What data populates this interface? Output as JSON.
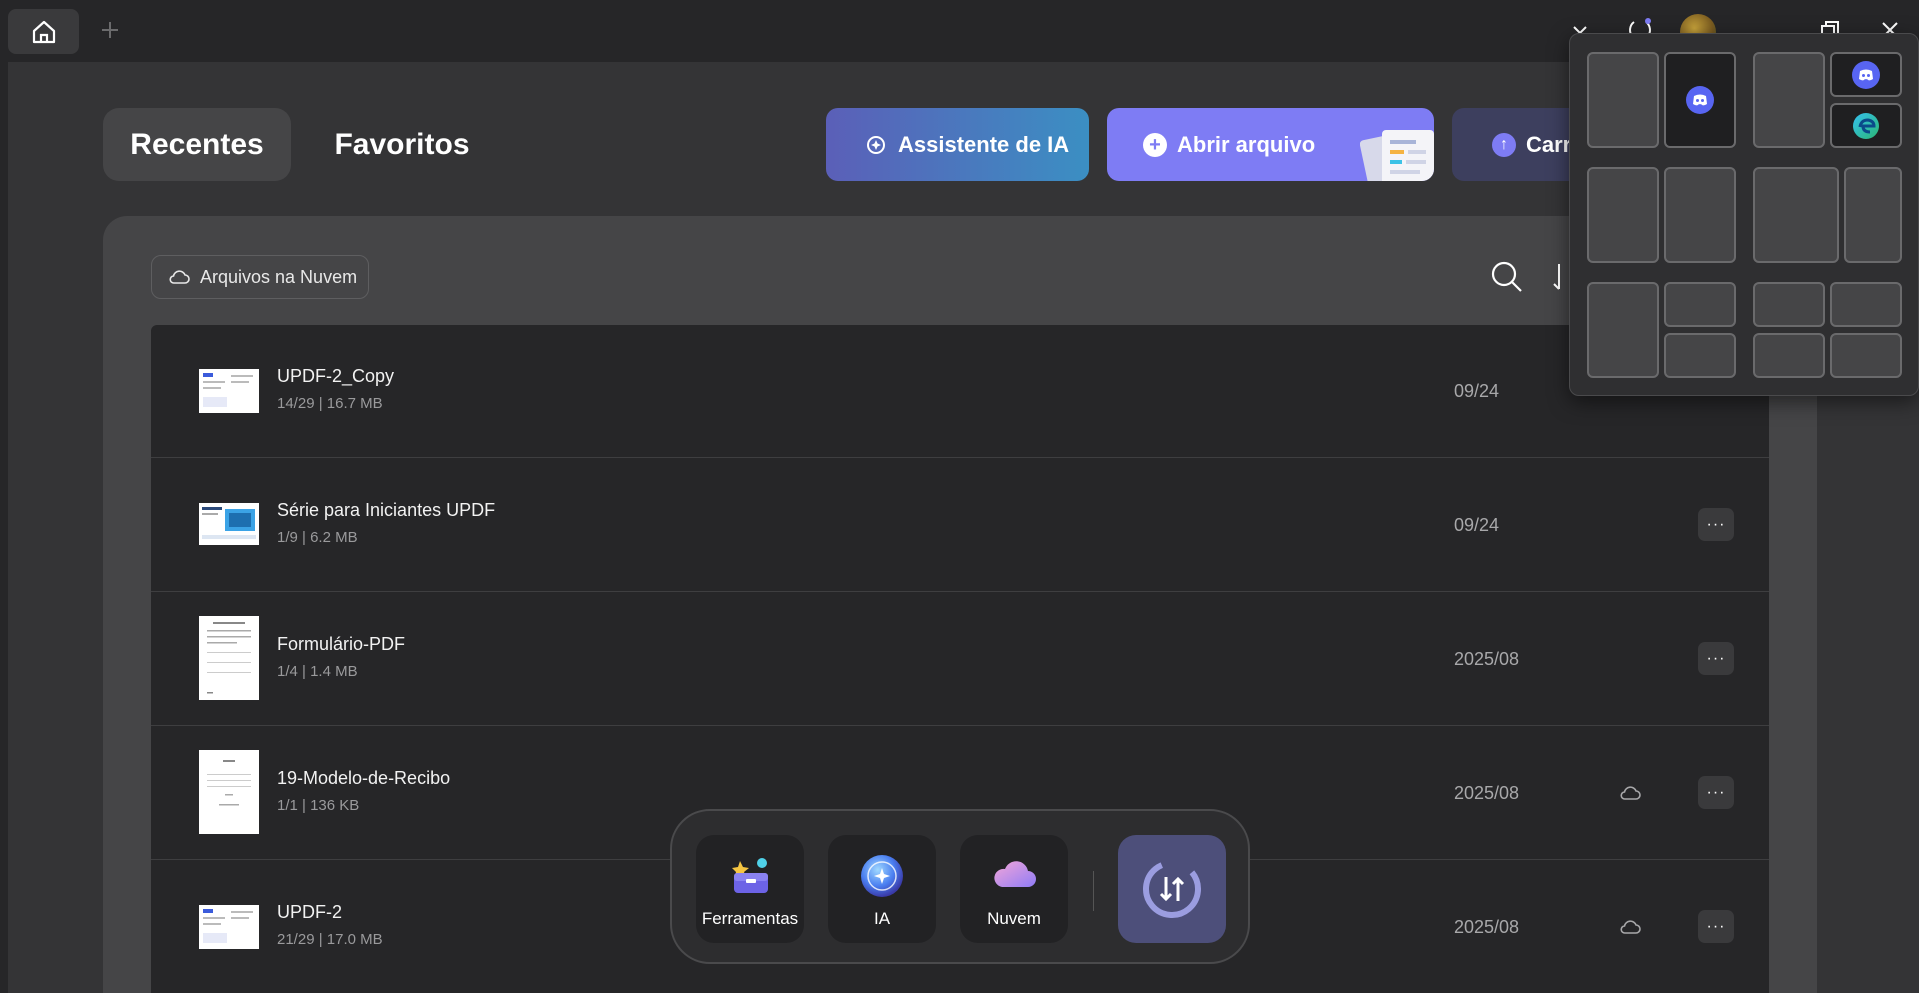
{
  "titlebar": {
    "home_icon": "home-icon",
    "new_tab_icon": "plus-icon",
    "controls": [
      "chevron-down-icon",
      "sync-icon",
      "avatar",
      "minimize-icon",
      "restore-icon",
      "close-icon"
    ]
  },
  "nav": {
    "recent_label": "Recentes",
    "favorites_label": "Favoritos"
  },
  "actions": {
    "ai_label": "Assistente de IA",
    "open_label": "Abrir arquivo",
    "upload_label": "Carr"
  },
  "filter": {
    "cloud_label": "Arquivos na Nuvem"
  },
  "files": [
    {
      "name": "UPDF-2_Copy",
      "meta": "14/29 | 16.7 MB",
      "date": "09/24",
      "cloud": false
    },
    {
      "name": "Série para Iniciantes UPDF",
      "meta": "1/9 | 6.2 MB",
      "date": "09/24",
      "cloud": false
    },
    {
      "name": "Formulário-PDF",
      "meta": "1/4 | 1.4 MB",
      "date": "2025/08",
      "cloud": false
    },
    {
      "name": "19-Modelo-de-Recibo",
      "meta": "1/1 | 136 KB",
      "date": "2025/08",
      "cloud": true
    },
    {
      "name": "UPDF-2",
      "meta": "21/29 | 17.0 MB",
      "date": "2025/08",
      "cloud": true
    }
  ],
  "more_label": "···",
  "dock": {
    "tools_label": "Ferramentas",
    "ai_label": "IA",
    "cloud_label": "Nuvem"
  },
  "snap_layout": {
    "apps": [
      "discord-icon",
      "discord-icon",
      "edge-icon"
    ]
  },
  "colors": {
    "accent": "#7e7cf4",
    "ai_gradient_start": "#5b5fb8",
    "ai_gradient_end": "#3b8fc3",
    "background": "#262628",
    "panel": "#454547"
  }
}
